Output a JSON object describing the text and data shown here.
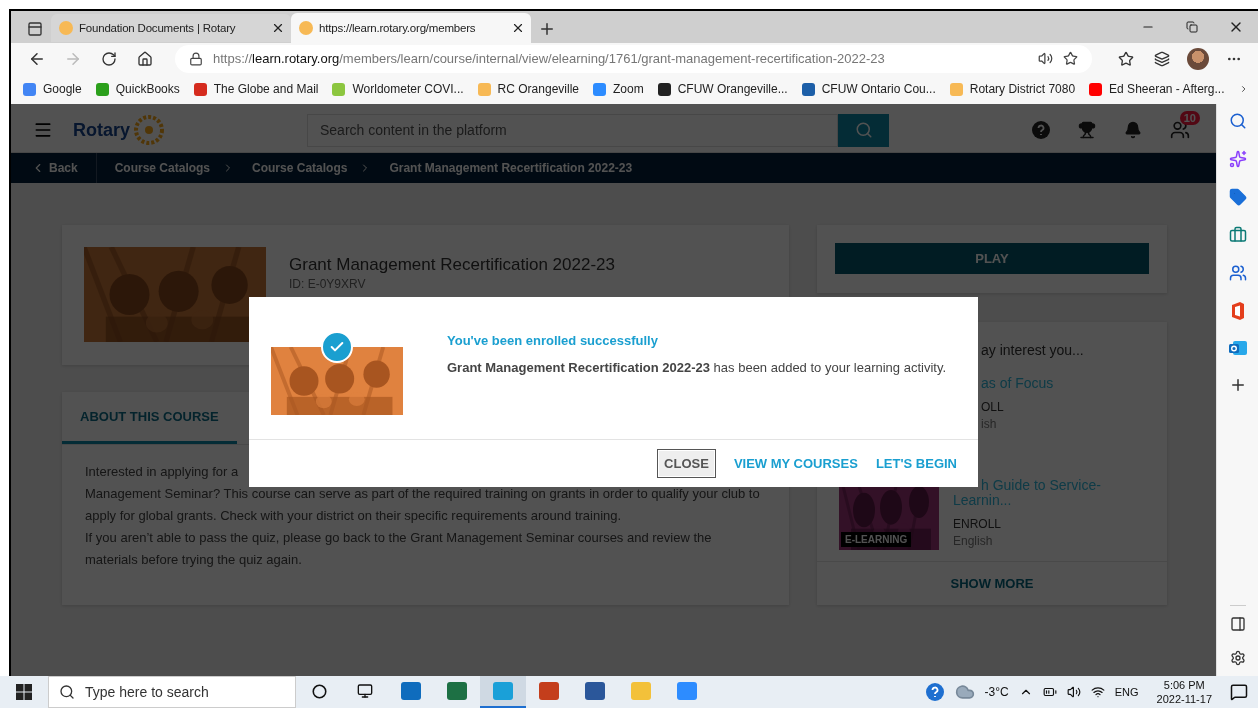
{
  "browser": {
    "tabs": [
      {
        "title": "Foundation Documents | Rotary",
        "selected": false
      },
      {
        "title": "https://learn.rotary.org/members",
        "selected": true
      }
    ],
    "forward": {
      "disabled": true
    },
    "address": {
      "scheme": "https://",
      "host": "learn.rotary.org",
      "path": "/members/learn/course/internal/view/elearning/1761/grant-management-recertification-2022-23"
    },
    "bookmarks": [
      {
        "label": "Google",
        "color": "#4285f4"
      },
      {
        "label": "QuickBooks",
        "color": "#2ca01c"
      },
      {
        "label": "The Globe and Mail",
        "color": "#d52b1e"
      },
      {
        "label": "Worldometer COVI...",
        "color": "#8cc63f"
      },
      {
        "label": "RC Orangeville",
        "color": "#f7b955"
      },
      {
        "label": "Zoom",
        "color": "#2d8cff"
      },
      {
        "label": "CFUW Orangeville...",
        "color": "#222222"
      },
      {
        "label": "CFUW Ontario Cou...",
        "color": "#1d5fa8"
      },
      {
        "label": "Rotary District 7080",
        "color": "#f7b955"
      },
      {
        "label": "Ed Sheeran - Afterg...",
        "color": "#ff0000"
      }
    ]
  },
  "site": {
    "logo": "Rotary",
    "search": {
      "placeholder": "Search content in the platform"
    },
    "notifications": "10",
    "breadcrumb": {
      "back": "Back",
      "items": [
        "Course Catalogs",
        "Course Catalogs",
        "Grant Management Recertification 2022-23"
      ]
    }
  },
  "course": {
    "title": "Grant Management Recertification 2022-23",
    "id": "ID: E-0Y9XRV",
    "tabs": [
      {
        "label": "ABOUT THIS COURSE",
        "selected": true
      }
    ],
    "description": [
      "Interested in applying for a",
      "Management Seminar? This course can serve as part of the required training on grants in order to qualify your club to apply for global grants. Check with your district on their specific requirements around training.",
      "If you aren’t able to pass the quiz, please go back to the Grant Management Seminar courses and review the materials before trying the quiz again."
    ]
  },
  "side": {
    "play": "PLAY",
    "heading": "ay interest you...",
    "items": [
      {
        "title": "as of Focus",
        "action": "OLL",
        "language": "ish"
      },
      {
        "title": "h Guide to Service-Learnin...",
        "thumbnail": {
          "kind": "picture",
          "badge": "E-LEARNING"
        },
        "action": "ENROLL",
        "language": "English"
      }
    ],
    "show_more": "SHOW MORE"
  },
  "dialog": {
    "heading": "You've been enrolled successfully",
    "message": "**Grant Management Recertification 2022-23** has been added to your learning activity.",
    "buttons": [
      {
        "label": "CLOSE",
        "kind": "secondary"
      },
      {
        "label": "VIEW MY COURSES",
        "kind": "link"
      },
      {
        "label": "LET'S BEGIN",
        "kind": "link"
      }
    ]
  },
  "taskbar": {
    "search": {
      "placeholder": "Type here to search"
    },
    "apps": [
      {
        "kind": "mail",
        "selected": false
      },
      {
        "kind": "sheet",
        "selected": false
      },
      {
        "kind": "browser",
        "selected": true
      },
      {
        "kind": "slides",
        "selected": false
      },
      {
        "kind": "doc",
        "selected": false
      },
      {
        "kind": "folder",
        "selected": false
      },
      {
        "kind": "video",
        "selected": false
      }
    ],
    "weather": "-3°C",
    "language": "ENG",
    "time": "5:06 PM",
    "date": "2022-11-17"
  }
}
